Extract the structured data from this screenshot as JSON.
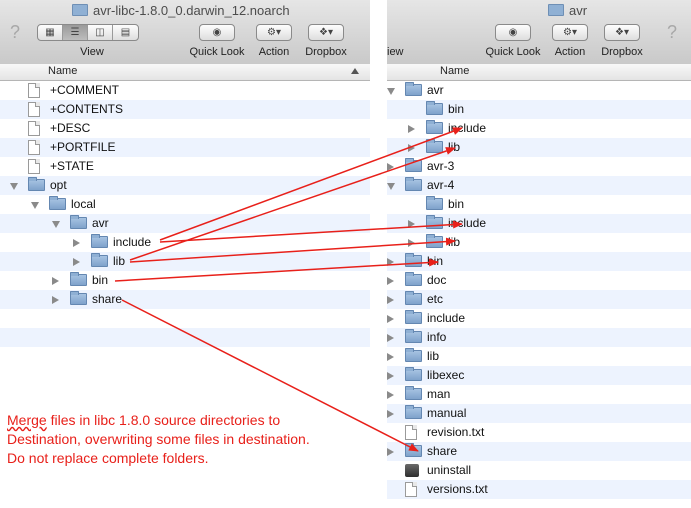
{
  "left_window": {
    "title": "avr-libc-1.8.0_0.darwin_12.noarch",
    "help": "?",
    "view_label": "View",
    "quick_look_label": "Quick Look",
    "action_label": "Action",
    "dropbox_label": "Dropbox",
    "column_name": "Name",
    "rows": [
      {
        "name": "+COMMENT",
        "kind": "file",
        "depth": 0,
        "expander": "none"
      },
      {
        "name": "+CONTENTS",
        "kind": "file",
        "depth": 0,
        "expander": "none"
      },
      {
        "name": "+DESC",
        "kind": "file",
        "depth": 0,
        "expander": "none"
      },
      {
        "name": "+PORTFILE",
        "kind": "file",
        "depth": 0,
        "expander": "none"
      },
      {
        "name": "+STATE",
        "kind": "file",
        "depth": 0,
        "expander": "none"
      },
      {
        "name": "opt",
        "kind": "folder",
        "depth": 0,
        "expander": "open"
      },
      {
        "name": "local",
        "kind": "folder",
        "depth": 1,
        "expander": "open"
      },
      {
        "name": "avr",
        "kind": "folder",
        "depth": 2,
        "expander": "open"
      },
      {
        "name": "include",
        "kind": "folder",
        "depth": 3,
        "expander": "closed"
      },
      {
        "name": "lib",
        "kind": "folder",
        "depth": 3,
        "expander": "closed"
      },
      {
        "name": "bin",
        "kind": "folder",
        "depth": 2,
        "expander": "closed"
      },
      {
        "name": "share",
        "kind": "folder",
        "depth": 2,
        "expander": "closed"
      },
      {
        "name": "",
        "kind": "empty",
        "depth": 0,
        "expander": "none"
      },
      {
        "name": "",
        "kind": "empty",
        "depth": 0,
        "expander": "none"
      }
    ]
  },
  "right_window": {
    "title": "avr",
    "help": "?",
    "view_label": "iew",
    "quick_look_label": "Quick Look",
    "action_label": "Action",
    "dropbox_label": "Dropbox",
    "column_name": "Name",
    "rows": [
      {
        "name": "avr",
        "kind": "folder",
        "depth": 0,
        "expander": "open"
      },
      {
        "name": "bin",
        "kind": "folder",
        "depth": 1,
        "expander": "none"
      },
      {
        "name": "include",
        "kind": "folder",
        "depth": 1,
        "expander": "closed"
      },
      {
        "name": "lib",
        "kind": "folder",
        "depth": 1,
        "expander": "closed"
      },
      {
        "name": "avr-3",
        "kind": "folder",
        "depth": 0,
        "expander": "closed"
      },
      {
        "name": "avr-4",
        "kind": "folder",
        "depth": 0,
        "expander": "open"
      },
      {
        "name": "bin",
        "kind": "folder",
        "depth": 1,
        "expander": "none"
      },
      {
        "name": "include",
        "kind": "folder",
        "depth": 1,
        "expander": "closed"
      },
      {
        "name": "lib",
        "kind": "folder",
        "depth": 1,
        "expander": "closed"
      },
      {
        "name": "bin",
        "kind": "folder",
        "depth": 0,
        "expander": "closed"
      },
      {
        "name": "doc",
        "kind": "folder",
        "depth": 0,
        "expander": "closed"
      },
      {
        "name": "etc",
        "kind": "folder",
        "depth": 0,
        "expander": "closed"
      },
      {
        "name": "include",
        "kind": "folder",
        "depth": 0,
        "expander": "closed"
      },
      {
        "name": "info",
        "kind": "folder",
        "depth": 0,
        "expander": "closed"
      },
      {
        "name": "lib",
        "kind": "folder",
        "depth": 0,
        "expander": "closed"
      },
      {
        "name": "libexec",
        "kind": "folder",
        "depth": 0,
        "expander": "closed"
      },
      {
        "name": "man",
        "kind": "folder",
        "depth": 0,
        "expander": "closed"
      },
      {
        "name": "manual",
        "kind": "folder",
        "depth": 0,
        "expander": "closed"
      },
      {
        "name": "revision.txt",
        "kind": "file",
        "depth": 0,
        "expander": "none"
      },
      {
        "name": "share",
        "kind": "folder",
        "depth": 0,
        "expander": "closed"
      },
      {
        "name": "uninstall",
        "kind": "exec",
        "depth": 0,
        "expander": "none"
      },
      {
        "name": "versions.txt",
        "kind": "file",
        "depth": 0,
        "expander": "none"
      }
    ]
  },
  "annotation": {
    "line1_word": "Merge",
    "line1_rest": " files in libc 1.8.0 source directories to",
    "line2": "Destination, overwriting some files in destination.",
    "line3": "Do not replace complete folders.",
    "color": "#e8201a"
  },
  "mappings": [
    {
      "from": "include",
      "to": "include"
    },
    {
      "from": "lib",
      "to": "lib"
    },
    {
      "from": "include",
      "to": "include"
    },
    {
      "from": "lib",
      "to": "lib"
    },
    {
      "from": "bin",
      "to": "bin"
    },
    {
      "from": "share",
      "to": "share"
    }
  ]
}
